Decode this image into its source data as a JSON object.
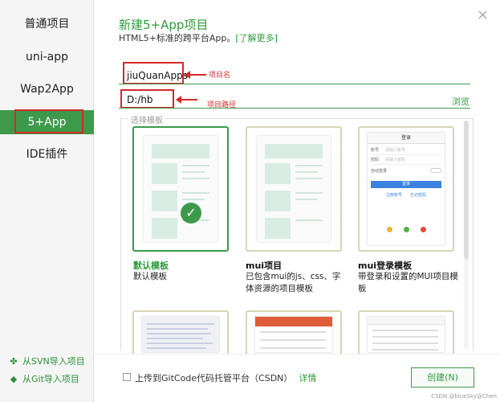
{
  "sidebar": {
    "items": [
      {
        "label": "普通项目"
      },
      {
        "label": "uni-app"
      },
      {
        "label": "Wap2App"
      },
      {
        "label": "5+App"
      },
      {
        "label": "IDE插件"
      }
    ],
    "import_svn": "从SVN导入项目",
    "import_git": "从Git导入项目"
  },
  "header": {
    "title": "新建5+App项目",
    "subtitle": "HTML5+标准的跨平台App。",
    "learn_more": "[了解更多]",
    "close_icon": "×"
  },
  "form": {
    "project_name_value": "jiuQuanApps",
    "project_name_annotation": "项目名",
    "path_value": "D:/hb",
    "path_annotation": "项目路径",
    "browse_label": "浏览"
  },
  "templates": {
    "group_label": "选择模板",
    "items": [
      {
        "title": "默认模板",
        "desc": "默认模板"
      },
      {
        "title": "mui项目",
        "desc": "已包含mui的js、css、字体资源的项目模板"
      },
      {
        "title": "mui登录模板",
        "desc": "带登录和设置的MUI项目模板"
      }
    ],
    "login_mock": {
      "header": "登录",
      "account": "账号",
      "account_ph": "请输入账号",
      "password": "密码",
      "password_ph": "请输入密码",
      "auto_login": "自动登录",
      "login_btn": "登录",
      "register": "注册账号",
      "forgot": "忘记密码"
    }
  },
  "footer": {
    "upload_label": "上传到GitCode代码托管平台（CSDN）",
    "details_label": "详情",
    "create_button": "创建(N)"
  },
  "watermark": "CSDN @blueSky@Chen",
  "colors": {
    "accent": "#3d9a4b",
    "annotation": "#d62828"
  }
}
